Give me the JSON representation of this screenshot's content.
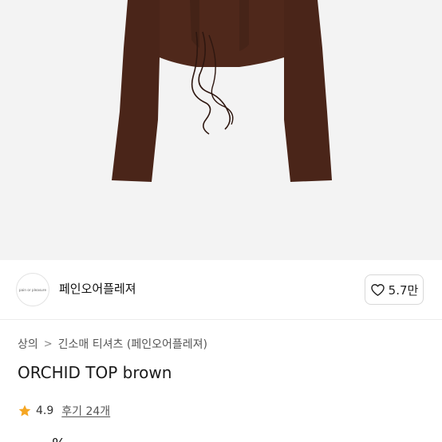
{
  "brand": {
    "logo_text": "pain or pleasure",
    "name": "페인오어플레져"
  },
  "like": {
    "icon": "heart-outline-icon",
    "count": "5.7만"
  },
  "breadcrumb": {
    "items": [
      "상의",
      "긴소매 티셔츠 (페인오어플레져)"
    ],
    "separator": ">"
  },
  "product": {
    "title": "ORCHID TOP brown",
    "color": "#4a2519"
  },
  "rating": {
    "icon": "star-icon",
    "star_color": "#f5a623",
    "score": "4.9",
    "reviews": "후기 24개"
  },
  "price": {
    "peek": "- - - -% -"
  }
}
